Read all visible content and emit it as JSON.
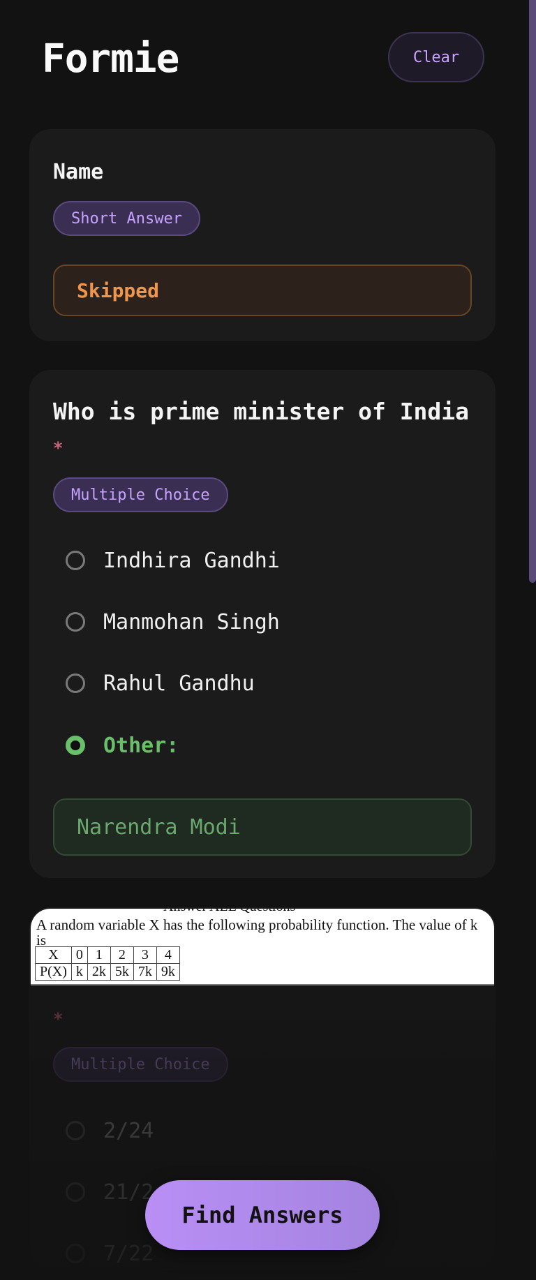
{
  "app": {
    "title": "Formie",
    "clear_label": "Clear"
  },
  "questions": [
    {
      "title": "Name",
      "type_label": "Short Answer",
      "answer_status": "Skipped"
    },
    {
      "title": "Who is prime minister of India",
      "required_mark": "*",
      "type_label": "Multiple Choice",
      "options": [
        "Indhira Gandhi",
        "Manmohan Singh",
        "Rahul Gandhu",
        "Other:"
      ],
      "selected_option": "Other:",
      "other_value": "Narendra Modi"
    },
    {
      "image": {
        "header_text": "Answer ALL Questions",
        "question_text": "A random variable X has the following probability function. The value of k is",
        "table": {
          "row_x": [
            "X",
            "0",
            "1",
            "2",
            "3",
            "4"
          ],
          "row_p": [
            "P(X)",
            "k",
            "2k",
            "5k",
            "7k",
            "9k"
          ]
        }
      },
      "required_mark": "*",
      "type_label": "Multiple Choice",
      "options": [
        "2/24",
        "21/2",
        "7/22"
      ]
    }
  ],
  "actions": {
    "find_answers_label": "Find Answers"
  },
  "colors": {
    "accent": "#b98ff5",
    "skipped": "#f0954a",
    "selected": "#6abf6a",
    "required": "#d0607c"
  }
}
